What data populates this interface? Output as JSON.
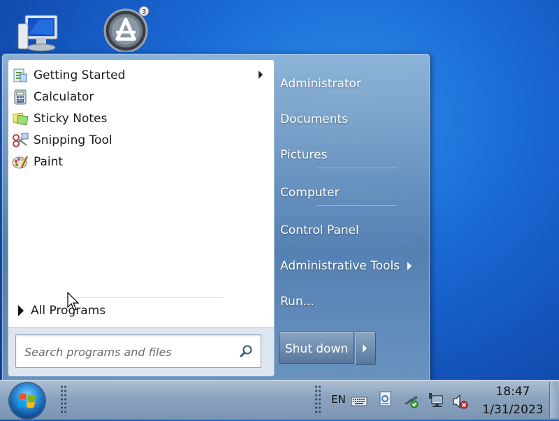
{
  "desktop": {
    "icons": [
      {
        "name": "computer",
        "label": ""
      },
      {
        "name": "avatar-app",
        "label": ""
      }
    ]
  },
  "start_menu": {
    "programs": [
      {
        "label": "Getting Started",
        "icon": "getting-started-icon",
        "has_submenu": true
      },
      {
        "label": "Calculator",
        "icon": "calculator-icon",
        "has_submenu": false
      },
      {
        "label": "Sticky Notes",
        "icon": "sticky-notes-icon",
        "has_submenu": false
      },
      {
        "label": "Snipping Tool",
        "icon": "snipping-tool-icon",
        "has_submenu": false
      },
      {
        "label": "Paint",
        "icon": "paint-icon",
        "has_submenu": false
      }
    ],
    "all_programs_label": "All Programs",
    "search": {
      "placeholder": "Search programs and files",
      "value": ""
    },
    "right_items": [
      {
        "label": "Administrator"
      },
      {
        "label": "Documents"
      },
      {
        "label": "Pictures"
      },
      {
        "label": "Computer"
      },
      {
        "label": "Control Panel"
      },
      {
        "label": "Administrative Tools",
        "has_submenu": true
      },
      {
        "label": "Run..."
      }
    ],
    "shutdown_label": "Shut down"
  },
  "taskbar": {
    "language": "EN",
    "clock_time": "18:47",
    "clock_date": "1/31/2023"
  },
  "colors": {
    "desktop_blue": "#1a6ad6",
    "taskbar": "#8aa2bd",
    "menu_left_bg": "#ffffff"
  }
}
